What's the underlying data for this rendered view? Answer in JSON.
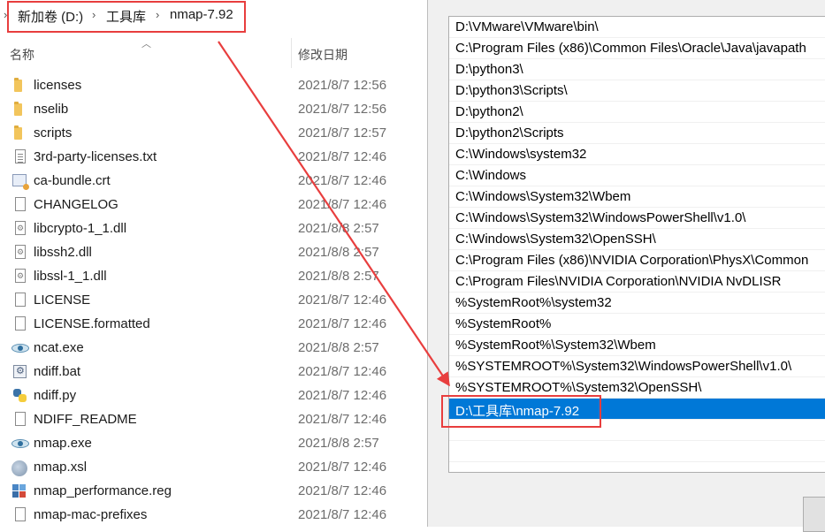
{
  "explorer": {
    "breadcrumb": [
      {
        "label": "新加卷 (D:)"
      },
      {
        "label": "工具库"
      },
      {
        "label": "nmap-7.92"
      }
    ],
    "columns": {
      "name": "名称",
      "modified": "修改日期"
    },
    "files": [
      {
        "name": "licenses",
        "date": "2021/8/7 12:56",
        "icon": "folder-icon"
      },
      {
        "name": "nselib",
        "date": "2021/8/7 12:56",
        "icon": "folder-icon"
      },
      {
        "name": "scripts",
        "date": "2021/8/7 12:57",
        "icon": "folder-icon"
      },
      {
        "name": "3rd-party-licenses.txt",
        "date": "2021/8/7 12:46",
        "icon": "text-file-icon"
      },
      {
        "name": "ca-bundle.crt",
        "date": "2021/8/7 12:46",
        "icon": "certificate-icon"
      },
      {
        "name": "CHANGELOG",
        "date": "2021/8/7 12:46",
        "icon": "file-icon"
      },
      {
        "name": "libcrypto-1_1.dll",
        "date": "2021/8/8 2:57",
        "icon": "dll-icon"
      },
      {
        "name": "libssh2.dll",
        "date": "2021/8/8 2:57",
        "icon": "dll-icon"
      },
      {
        "name": "libssl-1_1.dll",
        "date": "2021/8/8 2:57",
        "icon": "dll-icon"
      },
      {
        "name": "LICENSE",
        "date": "2021/8/7 12:46",
        "icon": "file-icon"
      },
      {
        "name": "LICENSE.formatted",
        "date": "2021/8/7 12:46",
        "icon": "file-icon"
      },
      {
        "name": "ncat.exe",
        "date": "2021/8/8 2:57",
        "icon": "exe-eye-icon"
      },
      {
        "name": "ndiff.bat",
        "date": "2021/8/7 12:46",
        "icon": "batch-file-icon"
      },
      {
        "name": "ndiff.py",
        "date": "2021/8/7 12:46",
        "icon": "python-file-icon"
      },
      {
        "name": "NDIFF_README",
        "date": "2021/8/7 12:46",
        "icon": "file-icon"
      },
      {
        "name": "nmap.exe",
        "date": "2021/8/8 2:57",
        "icon": "exe-eye-icon"
      },
      {
        "name": "nmap.xsl",
        "date": "2021/8/7 12:46",
        "icon": "xsl-file-icon"
      },
      {
        "name": "nmap_performance.reg",
        "date": "2021/8/7 12:46",
        "icon": "registry-file-icon"
      },
      {
        "name": "nmap-mac-prefixes",
        "date": "2021/8/7 12:46",
        "icon": "file-icon"
      }
    ]
  },
  "dialog": {
    "paths": [
      "D:\\VMware\\VMware\\bin\\",
      "C:\\Program Files (x86)\\Common Files\\Oracle\\Java\\javapath",
      "D:\\python3\\",
      "D:\\python3\\Scripts\\",
      "D:\\python2\\",
      "D:\\python2\\Scripts",
      "C:\\Windows\\system32",
      "C:\\Windows",
      "C:\\Windows\\System32\\Wbem",
      "C:\\Windows\\System32\\WindowsPowerShell\\v1.0\\",
      "C:\\Windows\\System32\\OpenSSH\\",
      "C:\\Program Files (x86)\\NVIDIA Corporation\\PhysX\\Common",
      "C:\\Program Files\\NVIDIA Corporation\\NVIDIA NvDLISR",
      "%SystemRoot%\\system32",
      "%SystemRoot%",
      "%SystemRoot%\\System32\\Wbem",
      "%SYSTEMROOT%\\System32\\WindowsPowerShell\\v1.0\\",
      "%SYSTEMROOT%\\System32\\OpenSSH\\",
      "D:\\工具库\\nmap-7.92"
    ],
    "selected_index": 18
  },
  "colors": {
    "selection": "#0078d7",
    "annotation": "#e83e3e"
  }
}
